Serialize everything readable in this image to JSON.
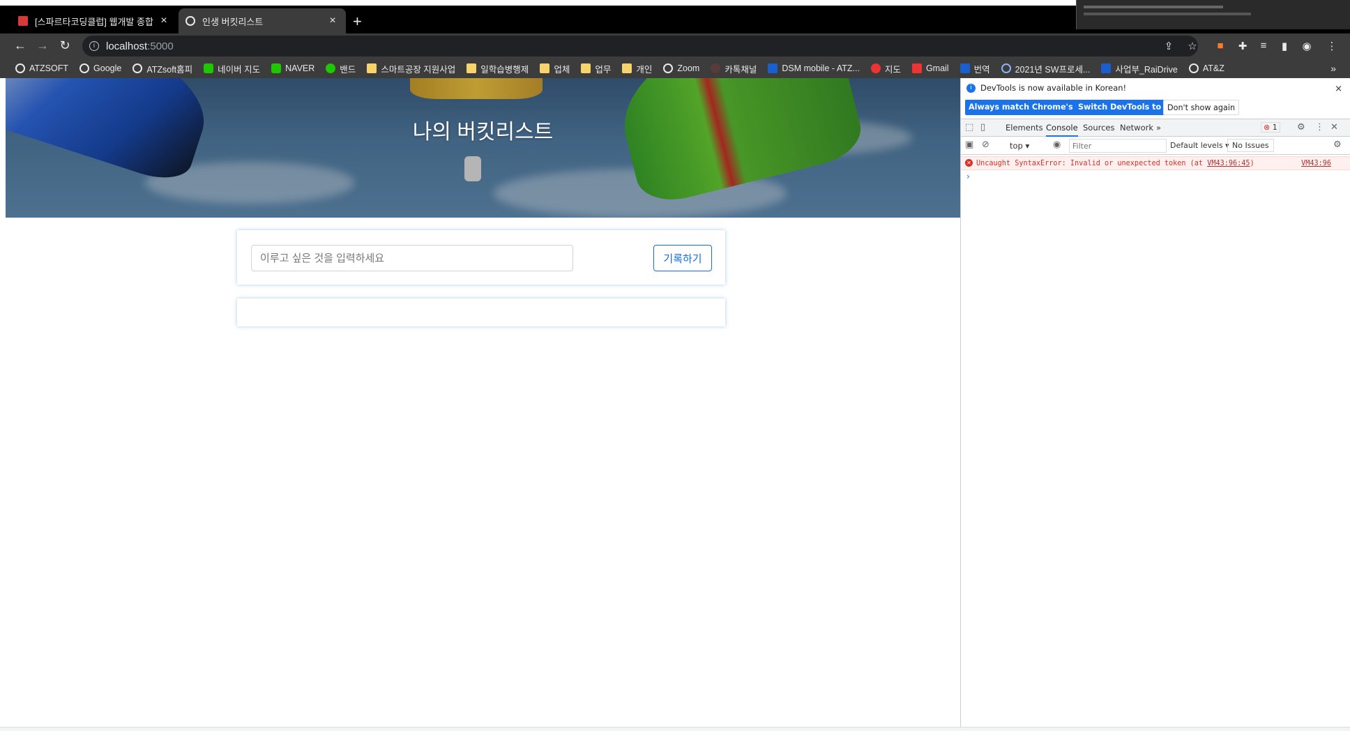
{
  "browser": {
    "tabs": [
      {
        "title": "[스파르타코딩클럽] 웹개발 종합",
        "active": false
      },
      {
        "title": "인생 버킷리스트",
        "active": true
      }
    ],
    "new_tab_label": "+",
    "address": {
      "host": "localhost",
      "port": ":5000"
    },
    "bookmarks": [
      {
        "label": "ATZSOFT",
        "icon": "globe-icon"
      },
      {
        "label": "Google",
        "icon": "google-icon"
      },
      {
        "label": "ATZsoft홈피",
        "icon": "globe-icon"
      },
      {
        "label": "네이버 지도",
        "icon": "naver-map-icon"
      },
      {
        "label": "NAVER",
        "icon": "naver-icon"
      },
      {
        "label": "밴드",
        "icon": "band-icon"
      },
      {
        "label": "스마트공장 지원사업",
        "icon": "folder-icon"
      },
      {
        "label": "일학습병행제",
        "icon": "folder-icon"
      },
      {
        "label": "업체",
        "icon": "folder-icon"
      },
      {
        "label": "업무",
        "icon": "folder-icon"
      },
      {
        "label": "개인",
        "icon": "folder-icon"
      },
      {
        "label": "Zoom",
        "icon": "globe-icon"
      },
      {
        "label": "카톡채널",
        "icon": "kakao-icon"
      },
      {
        "label": "DSM mobile - ATZ...",
        "icon": "dsm-icon"
      },
      {
        "label": "지도",
        "icon": "map-pin-icon"
      },
      {
        "label": "Gmail",
        "icon": "gmail-icon"
      },
      {
        "label": "번역",
        "icon": "translate-icon"
      },
      {
        "label": "2021년 SW프로세...",
        "icon": "c-icon"
      },
      {
        "label": "사업부_RaiDrive",
        "icon": "dsm-icon"
      },
      {
        "label": "AT&Z",
        "icon": "globe-icon"
      }
    ],
    "bookmarks_more": "»"
  },
  "page": {
    "hero_title": "나의 버킷리스트",
    "input_placeholder": "이루고 싶은 것을 입력하세요",
    "input_value": "",
    "save_button": "기록하기"
  },
  "devtools": {
    "info_text": "DevTools is now available in Korean!",
    "buttons": {
      "match": "Always match Chrome's language",
      "switch": "Switch DevTools to Korean",
      "dont_show": "Don't show again"
    },
    "tabs": [
      "Elements",
      "Console",
      "Sources",
      "Network"
    ],
    "active_tab": "Console",
    "more_tabs": "»",
    "error_count": "1",
    "context": "top",
    "filter_placeholder": "Filter",
    "levels": "Default levels",
    "issues": "No Issues",
    "error_message": "Uncaught SyntaxError: Invalid or unexpected token (at ",
    "error_link": "VM43:96:45",
    "error_close": ")",
    "error_source": "VM43:96",
    "prompt": "›"
  },
  "colors": {
    "accent": "#0d6efd",
    "devtools_primary": "#1a73e8",
    "error": "#d93025"
  }
}
